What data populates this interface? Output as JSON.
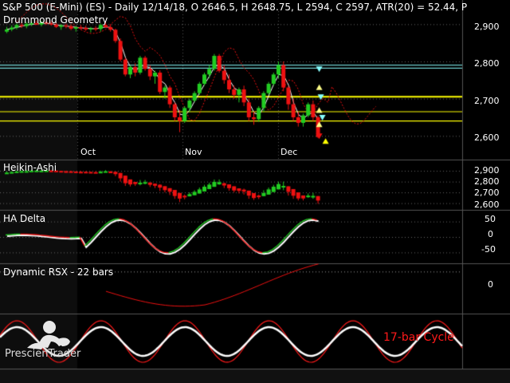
{
  "title": "S&P 500 (E-Mini) (ES) - Daily 12/14/18, O 2646.5, H 2648.75, L 2594, C 2597, ATR(20) = 52.44, P",
  "brand": "PrescienTrader",
  "colors": {
    "bull": "#22cc22",
    "bear": "#ee1111",
    "yellow_line": "#ffff00",
    "cyan_line": "#88ffff",
    "cycle": "#ff1a1a",
    "white": "#ffffff"
  },
  "chart_data": [
    {
      "type": "candlestick",
      "panel": "price",
      "label": "Drummond Geometry",
      "y_ticks": [
        "2,900",
        "2,800",
        "2,700",
        "2,600"
      ],
      "x_ticks": [
        "Oct",
        "Nov",
        "Dec"
      ],
      "ylim": [
        2575,
        2935
      ],
      "candles_ohlc": [
        [
          2880,
          2893,
          2876,
          2886
        ],
        [
          2886,
          2897,
          2881,
          2891
        ],
        [
          2891,
          2902,
          2886,
          2898
        ],
        [
          2898,
          2905,
          2890,
          2895
        ],
        [
          2895,
          2906,
          2889,
          2901
        ],
        [
          2901,
          2908,
          2895,
          2903
        ],
        [
          2903,
          2910,
          2898,
          2899
        ],
        [
          2899,
          2909,
          2894,
          2905
        ],
        [
          2905,
          2910,
          2898,
          2902
        ],
        [
          2902,
          2908,
          2896,
          2899
        ],
        [
          2899,
          2904,
          2890,
          2893
        ],
        [
          2893,
          2900,
          2885,
          2897
        ],
        [
          2897,
          2902,
          2889,
          2895
        ],
        [
          2895,
          2900,
          2884,
          2888
        ],
        [
          2888,
          2895,
          2880,
          2892
        ],
        [
          2892,
          2898,
          2885,
          2890
        ],
        [
          2890,
          2896,
          2882,
          2886
        ],
        [
          2886,
          2893,
          2878,
          2889
        ],
        [
          2889,
          2895,
          2881,
          2887
        ],
        [
          2887,
          2902,
          2880,
          2898
        ],
        [
          2898,
          2906,
          2890,
          2892
        ],
        [
          2892,
          2900,
          2880,
          2885
        ],
        [
          2885,
          2888,
          2850,
          2855
        ],
        [
          2855,
          2862,
          2800,
          2805
        ],
        [
          2805,
          2810,
          2760,
          2765
        ],
        [
          2765,
          2790,
          2755,
          2785
        ],
        [
          2785,
          2795,
          2760,
          2770
        ],
        [
          2770,
          2815,
          2765,
          2810
        ],
        [
          2810,
          2815,
          2775,
          2780
        ],
        [
          2780,
          2790,
          2750,
          2760
        ],
        [
          2760,
          2775,
          2740,
          2770
        ],
        [
          2770,
          2776,
          2712,
          2718
        ],
        [
          2718,
          2735,
          2700,
          2730
        ],
        [
          2730,
          2735,
          2675,
          2685
        ],
        [
          2685,
          2690,
          2640,
          2650
        ],
        [
          2650,
          2670,
          2610,
          2640
        ],
        [
          2640,
          2680,
          2635,
          2675
        ],
        [
          2675,
          2700,
          2665,
          2695
        ],
        [
          2695,
          2720,
          2690,
          2715
        ],
        [
          2715,
          2745,
          2710,
          2740
        ],
        [
          2740,
          2770,
          2735,
          2765
        ],
        [
          2765,
          2790,
          2755,
          2780
        ],
        [
          2780,
          2820,
          2775,
          2815
        ],
        [
          2815,
          2820,
          2770,
          2775
        ],
        [
          2775,
          2790,
          2740,
          2750
        ],
        [
          2750,
          2765,
          2715,
          2725
        ],
        [
          2725,
          2735,
          2700,
          2710
        ],
        [
          2710,
          2730,
          2690,
          2725
        ],
        [
          2725,
          2735,
          2680,
          2690
        ],
        [
          2690,
          2700,
          2640,
          2650
        ],
        [
          2650,
          2665,
          2630,
          2645
        ],
        [
          2645,
          2680,
          2638,
          2675
        ],
        [
          2675,
          2720,
          2665,
          2715
        ],
        [
          2715,
          2745,
          2710,
          2740
        ],
        [
          2740,
          2770,
          2735,
          2765
        ],
        [
          2765,
          2800,
          2755,
          2790
        ],
        [
          2790,
          2800,
          2720,
          2730
        ],
        [
          2730,
          2735,
          2670,
          2685
        ],
        [
          2685,
          2700,
          2640,
          2650
        ],
        [
          2650,
          2665,
          2625,
          2635
        ],
        [
          2635,
          2660,
          2625,
          2655
        ],
        [
          2655,
          2690,
          2650,
          2685
        ],
        [
          2685,
          2695,
          2640,
          2650
        ],
        [
          2650,
          2655,
          2594,
          2597
        ]
      ],
      "overlays": {
        "yellow_levels": [
          2705,
          2665,
          2640
        ],
        "cyan_levels": [
          2790,
          2782
        ]
      }
    },
    {
      "type": "candlestick",
      "panel": "heikin-ashi",
      "label": "Heikin-Ashi",
      "y_ticks": [
        "2,900",
        "2,800",
        "2,700",
        "2,600"
      ],
      "ylim": [
        2560,
        2960
      ]
    },
    {
      "type": "line",
      "panel": "ha-delta",
      "label": "HA Delta",
      "y_ticks": [
        "50",
        "0",
        "-50"
      ],
      "ylim": [
        -80,
        80
      ]
    },
    {
      "type": "line",
      "panel": "rsx",
      "label": "Dynamic RSX - 22 bars",
      "y_ticks": [
        "0"
      ],
      "ylim": [
        -80,
        10
      ]
    },
    {
      "type": "line",
      "panel": "cycle",
      "label": "17-bar Cycle",
      "period_bars": 17
    }
  ]
}
